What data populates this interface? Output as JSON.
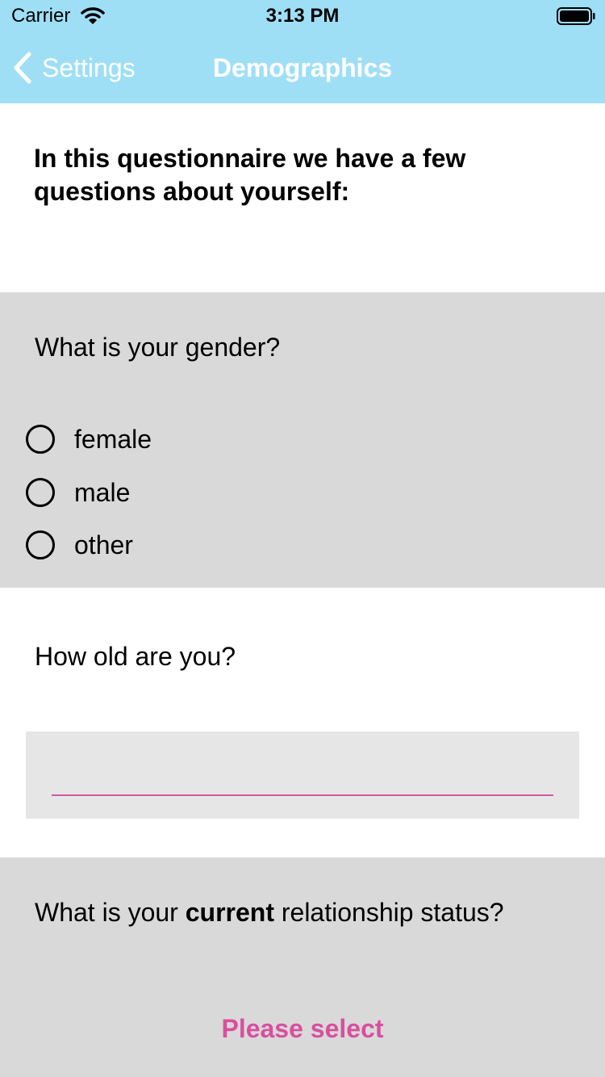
{
  "status_bar": {
    "carrier": "Carrier",
    "time": "3:13 PM"
  },
  "nav": {
    "back_label": "Settings",
    "title": "Demographics",
    "bar_color": "#9fdff6"
  },
  "intro": "In this questionnaire we have a few questions about yourself:",
  "gender": {
    "question": "What is your gender?",
    "options": [
      "female",
      "male",
      "other"
    ]
  },
  "age": {
    "question": "How old are you?",
    "value": ""
  },
  "relationship": {
    "question_prefix": "What is your ",
    "question_bold": "current",
    "question_suffix": " relationship status?",
    "select_label": "Please select",
    "accent_color": "#d94f9e"
  }
}
